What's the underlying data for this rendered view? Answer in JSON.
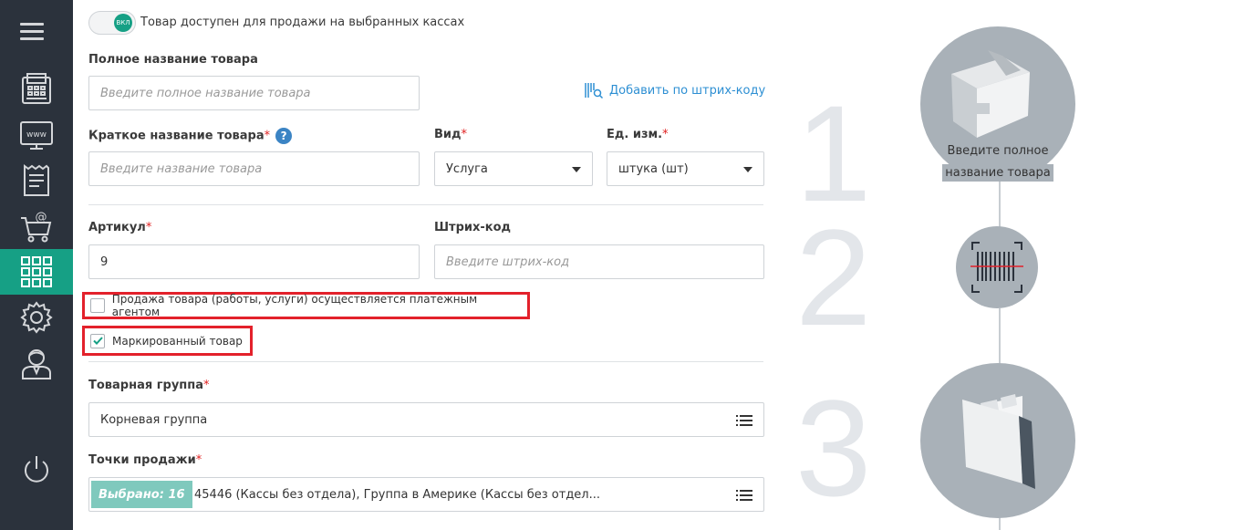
{
  "sidebar": {
    "items": [
      {
        "name": "cash-register-icon"
      },
      {
        "name": "www-icon"
      },
      {
        "name": "receipt-icon"
      },
      {
        "name": "shopping-cart-at-icon"
      },
      {
        "name": "grid-icon"
      },
      {
        "name": "gear-icon"
      },
      {
        "name": "user-icon"
      }
    ],
    "power_icon": "power-icon"
  },
  "form": {
    "toggle": {
      "knob_label": "ВКЛ",
      "text": "Товар доступен для продажи на выбранных кассах"
    },
    "full_name": {
      "label": "Полное название товара",
      "placeholder": "Введите полное название товара"
    },
    "barcode_link": "Добавить по штрих-коду",
    "short_name": {
      "label": "Краткое название товара",
      "placeholder": "Введите название товара",
      "help": "?"
    },
    "kind": {
      "label": "Вид",
      "value": "Услуга"
    },
    "unit": {
      "label": "Ед. изм.",
      "value": "штука (шт)"
    },
    "article": {
      "label": "Артикул",
      "value": "9"
    },
    "barcode": {
      "label": "Штрих-код",
      "placeholder": "Введите штрих-код"
    },
    "agent_checkbox": {
      "label": "Продажа товара (работы, услуги) осуществляется платежным агентом",
      "checked": false
    },
    "marked_checkbox": {
      "label": "Маркированный товар",
      "checked": true
    },
    "group": {
      "label": "Товарная группа",
      "value": "Корневая группа"
    },
    "points": {
      "label": "Точки продажи",
      "badge": "Выбрано: 16",
      "value": "45446 (Кассы без отдела), Группа в Америке (Кассы без отдел..."
    },
    "required_mark": "*"
  },
  "steps": {
    "numbers": [
      "1",
      "2",
      "3"
    ],
    "step1_caption_line1": "Введите полное",
    "step1_caption_line2": "название товара"
  },
  "colors": {
    "sidebar_bg": "#2b323c",
    "accent": "#16a085",
    "highlight_border": "#e3212b",
    "link": "#2d8fd3"
  }
}
